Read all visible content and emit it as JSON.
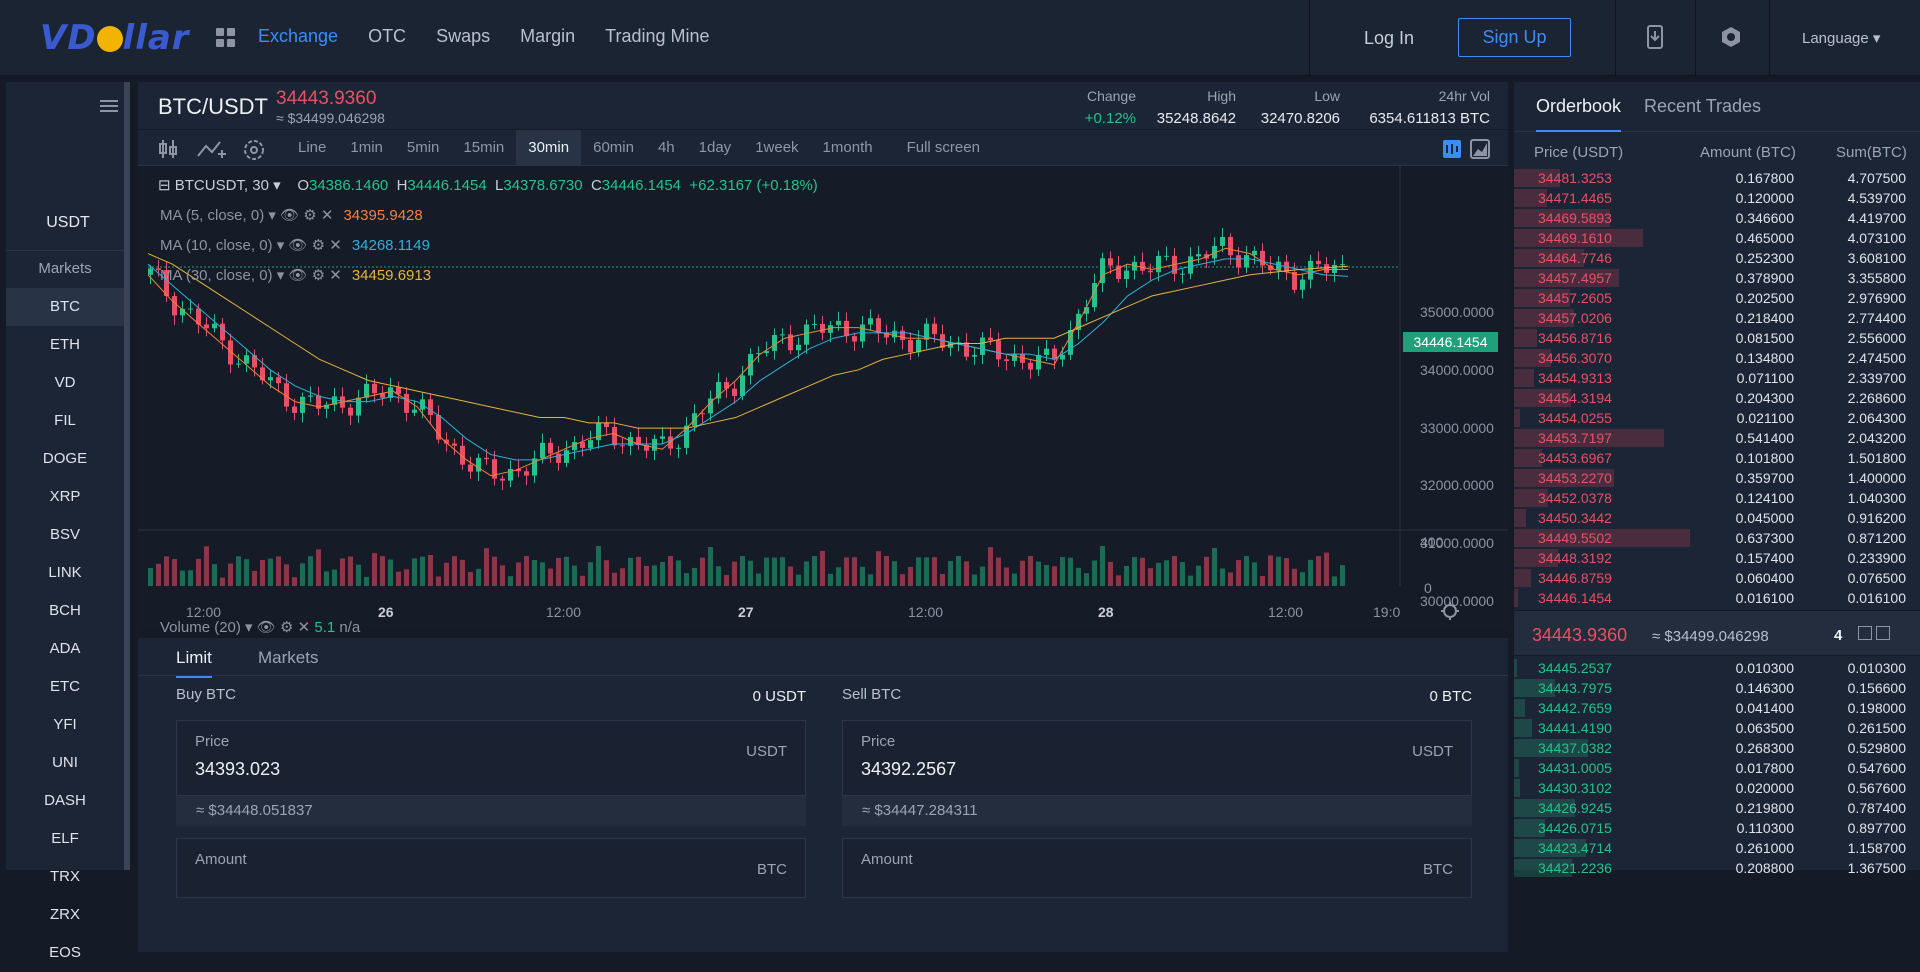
{
  "brand": {
    "logo_left": "VD",
    "logo_right": "llar"
  },
  "nav": {
    "items": [
      "Exchange",
      "OTC",
      "Swaps",
      "Margin",
      "Trading Mine"
    ],
    "active": "Exchange"
  },
  "auth": {
    "login": "Log In",
    "signup": "Sign Up"
  },
  "language": "Language",
  "sidebar": {
    "quote": "USDT",
    "markets_label": "Markets",
    "coins": [
      "BTC",
      "ETH",
      "VD",
      "FIL",
      "DOGE",
      "XRP",
      "BSV",
      "LINK",
      "BCH",
      "ADA",
      "ETC",
      "YFI",
      "UNI",
      "DASH",
      "ELF",
      "TRX",
      "ZRX",
      "EOS"
    ],
    "active": "BTC"
  },
  "ticker": {
    "pair": "BTC/USDT",
    "price": "34443.9360",
    "price_usd": "≈ $34499.046298",
    "stats": [
      {
        "label": "Change",
        "value": "+0.12%",
        "color": "green"
      },
      {
        "label": "High",
        "value": "35248.8642"
      },
      {
        "label": "Low",
        "value": "32470.8206"
      },
      {
        "label": "24hr Vol",
        "value": "6354.611813 BTC"
      }
    ]
  },
  "toolbar": {
    "intervals": [
      "Line",
      "1min",
      "5min",
      "15min",
      "30min",
      "60min",
      "4h",
      "1day",
      "1week",
      "1month",
      "Full screen"
    ],
    "active": "30min"
  },
  "chart_legend": {
    "symbol": "BTCUSDT, 30",
    "open": "34386.1460",
    "high": "34446.1454",
    "low": "34378.6730",
    "close": "34446.1454",
    "change": "+62.3167 (+0.18%)",
    "ma5_label": "MA (5, close, 0)",
    "ma5_value": "34395.9428",
    "ma10_label": "MA (10, close, 0)",
    "ma10_value": "34268.1149",
    "ma30_label": "MA (30, close, 0)",
    "ma30_value": "34459.6913",
    "volume_label": "Volume (20)",
    "volume_value": "5.1",
    "volume_na": "n/a",
    "last_price": "34446.1454"
  },
  "colors": {
    "up": "#27c289",
    "down": "#ec4f62",
    "ma5": "#f5813a",
    "ma10": "#2fb0d8",
    "ma30": "#e8b23c",
    "accent": "#3b8cff"
  },
  "chart_data": {
    "type": "line",
    "title": "",
    "x_ticks": [
      "12:00",
      "26",
      "12:00",
      "27",
      "12:00",
      "28",
      "12:00",
      "19:0"
    ],
    "y_ticks": [
      "35000.0000",
      "34000.0000",
      "33000.0000",
      "32000.0000",
      "31000.0000",
      "30000.0000"
    ],
    "volume_ticks": [
      "400",
      "0"
    ],
    "ylim": [
      29700,
      35600
    ],
    "series": [
      {
        "name": "MA (5, close, 0)",
        "values": [
          34300,
          33800,
          33400,
          33000,
          32600,
          32200,
          31900,
          31800,
          31900,
          32000,
          32100,
          31800,
          31200,
          30800,
          30500,
          30600,
          30800,
          31000,
          31200,
          31300,
          31100,
          31000,
          31400,
          31900,
          32300,
          32800,
          33100,
          33200,
          33300,
          33300,
          33200,
          33100,
          33100,
          33000,
          32900,
          32800,
          32700,
          32600,
          33400,
          34300,
          34500,
          34400,
          34500,
          34600,
          34800,
          34700,
          34400,
          34300,
          34400,
          34400
        ]
      },
      {
        "name": "MA (10, close, 0)",
        "values": [
          34500,
          34100,
          33700,
          33300,
          32900,
          32500,
          32200,
          32000,
          31900,
          31900,
          32000,
          31900,
          31600,
          31200,
          30900,
          30800,
          30800,
          30900,
          31000,
          31100,
          31100,
          31100,
          31300,
          31600,
          31900,
          32300,
          32600,
          32900,
          33100,
          33200,
          33200,
          33200,
          33100,
          33000,
          32900,
          32800,
          32800,
          32700,
          33000,
          33400,
          33900,
          34200,
          34400,
          34500,
          34600,
          34600,
          34500,
          34400,
          34300,
          34270
        ]
      },
      {
        "name": "MA (30, close, 0)",
        "values": [
          34700,
          34500,
          34200,
          33900,
          33600,
          33300,
          33000,
          32700,
          32500,
          32300,
          32200,
          32100,
          32000,
          31900,
          31800,
          31700,
          31600,
          31600,
          31500,
          31500,
          31400,
          31400,
          31400,
          31500,
          31600,
          31800,
          32000,
          32200,
          32400,
          32500,
          32700,
          32800,
          32900,
          33000,
          33000,
          33100,
          33100,
          33100,
          33300,
          33500,
          33700,
          33900,
          34000,
          34100,
          34200,
          34300,
          34350,
          34400,
          34430,
          34460
        ]
      }
    ]
  },
  "order_form": {
    "tabs": [
      "Limit",
      "Markets"
    ],
    "active": "Limit",
    "buy": {
      "title": "Buy BTC",
      "balance": "0 USDT",
      "price_label": "Price",
      "price": "34393.023",
      "price_unit": "USDT",
      "approx": "≈ $34448.051837",
      "amount_label": "Amount",
      "amount_unit": "BTC"
    },
    "sell": {
      "title": "Sell BTC",
      "balance": "0 BTC",
      "price_label": "Price",
      "price": "34392.2567",
      "price_unit": "USDT",
      "approx": "≈ $34447.284311",
      "amount_label": "Amount",
      "amount_unit": "BTC"
    }
  },
  "orderbook": {
    "tabs": [
      "Orderbook",
      "Recent Trades"
    ],
    "active": "Orderbook",
    "headers": [
      "Price (USDT)",
      "Amount (BTC)",
      "Sum(BTC)"
    ],
    "asks": [
      {
        "price": "34481.3253",
        "amount": "0.167800",
        "sum": "4.707500"
      },
      {
        "price": "34471.4465",
        "amount": "0.120000",
        "sum": "4.539700"
      },
      {
        "price": "34469.5893",
        "amount": "0.346600",
        "sum": "4.419700"
      },
      {
        "price": "34469.1610",
        "amount": "0.465000",
        "sum": "4.073100"
      },
      {
        "price": "34464.7746",
        "amount": "0.252300",
        "sum": "3.608100"
      },
      {
        "price": "34457.4957",
        "amount": "0.378900",
        "sum": "3.355800"
      },
      {
        "price": "34457.2605",
        "amount": "0.202500",
        "sum": "2.976900"
      },
      {
        "price": "34457.0206",
        "amount": "0.218400",
        "sum": "2.774400"
      },
      {
        "price": "34456.8716",
        "amount": "0.081500",
        "sum": "2.556000"
      },
      {
        "price": "34456.3070",
        "amount": "0.134800",
        "sum": "2.474500"
      },
      {
        "price": "34454.9313",
        "amount": "0.071100",
        "sum": "2.339700"
      },
      {
        "price": "34454.3194",
        "amount": "0.204300",
        "sum": "2.268600"
      },
      {
        "price": "34454.0255",
        "amount": "0.021100",
        "sum": "2.064300"
      },
      {
        "price": "34453.7197",
        "amount": "0.541400",
        "sum": "2.043200"
      },
      {
        "price": "34453.6967",
        "amount": "0.101800",
        "sum": "1.501800"
      },
      {
        "price": "34453.2270",
        "amount": "0.359700",
        "sum": "1.400000"
      },
      {
        "price": "34452.0378",
        "amount": "0.124100",
        "sum": "1.040300"
      },
      {
        "price": "34450.3442",
        "amount": "0.045000",
        "sum": "0.916200"
      },
      {
        "price": "34449.5502",
        "amount": "0.637300",
        "sum": "0.871200"
      },
      {
        "price": "34448.3192",
        "amount": "0.157400",
        "sum": "0.233900"
      },
      {
        "price": "34446.8759",
        "amount": "0.060400",
        "sum": "0.076500"
      },
      {
        "price": "34446.1454",
        "amount": "0.016100",
        "sum": "0.016100"
      }
    ],
    "mid_price": "34443.9360",
    "mid_usd": "≈ $34499.046298",
    "depth": "4",
    "bids": [
      {
        "price": "34445.2537",
        "amount": "0.010300",
        "sum": "0.010300"
      },
      {
        "price": "34443.7975",
        "amount": "0.146300",
        "sum": "0.156600"
      },
      {
        "price": "34442.7659",
        "amount": "0.041400",
        "sum": "0.198000"
      },
      {
        "price": "34441.4190",
        "amount": "0.063500",
        "sum": "0.261500"
      },
      {
        "price": "34437.0382",
        "amount": "0.268300",
        "sum": "0.529800"
      },
      {
        "price": "34431.0005",
        "amount": "0.017800",
        "sum": "0.547600"
      },
      {
        "price": "34430.3102",
        "amount": "0.020000",
        "sum": "0.567600"
      },
      {
        "price": "34426.9245",
        "amount": "0.219800",
        "sum": "0.787400"
      },
      {
        "price": "34426.0715",
        "amount": "0.110300",
        "sum": "0.897700"
      },
      {
        "price": "34423.4714",
        "amount": "0.261000",
        "sum": "1.158700"
      },
      {
        "price": "34421.2236",
        "amount": "0.208800",
        "sum": "1.367500"
      }
    ]
  }
}
